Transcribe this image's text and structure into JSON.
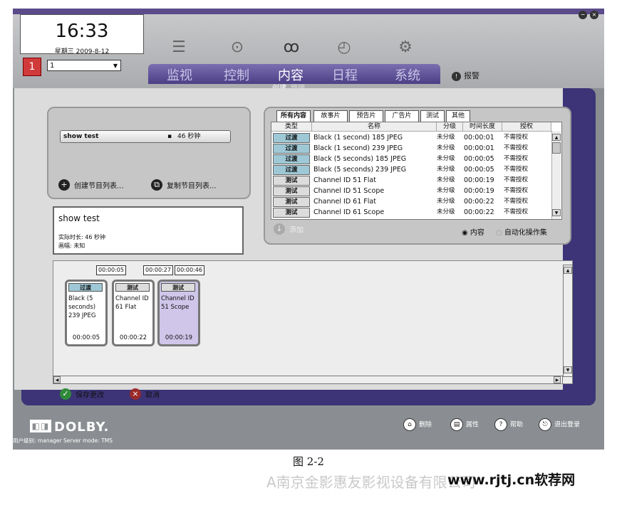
{
  "clock": {
    "time": "16:33",
    "date": "星期三 2009-8-12"
  },
  "screen": {
    "badge": "1",
    "selected": "1"
  },
  "nav": {
    "tabs": [
      "监视",
      "控制",
      "内容",
      "日程",
      "系统"
    ],
    "active": "内容",
    "alarm": "报警"
  },
  "subnav": {
    "create": "创建",
    "manage": "管理"
  },
  "playlists": {
    "items": [
      {
        "name": "show test",
        "duration": "46 秒钟"
      }
    ],
    "create_button": "创建节目列表...",
    "copy_button": "复制节目列表..."
  },
  "detail": {
    "title": "show test",
    "actual_duration": "实际时长: 46 秒钟",
    "aspect": "画幅: 未知"
  },
  "content_tabs": [
    "所有内容",
    "故事片",
    "预告片",
    "广告片",
    "测试",
    "其他"
  ],
  "content_table": {
    "headers": [
      "类型",
      "名称",
      "分级",
      "时间长度",
      "授权"
    ],
    "rows": [
      {
        "type": "过渡",
        "name": "Black (1 second) 185 JPEG",
        "rating": "未分级",
        "length": "00:00:01",
        "license": "不需授权"
      },
      {
        "type": "过渡",
        "name": "Black (1 second) 239 JPEG",
        "rating": "未分级",
        "length": "00:00:01",
        "license": "不需授权"
      },
      {
        "type": "过渡",
        "name": "Black (5 seconds) 185 JPEG",
        "rating": "未分级",
        "length": "00:00:05",
        "license": "不需授权"
      },
      {
        "type": "过渡",
        "name": "Black (5 seconds) 239 JPEG",
        "rating": "未分级",
        "length": "00:00:05",
        "license": "不需授权"
      },
      {
        "type": "测试",
        "name": "Channel ID 51 Flat",
        "rating": "未分级",
        "length": "00:00:19",
        "license": "不需授权"
      },
      {
        "type": "测试",
        "name": "Channel ID 51 Scope",
        "rating": "未分级",
        "length": "00:00:19",
        "license": "不需授权"
      },
      {
        "type": "测试",
        "name": "Channel ID 61 Flat",
        "rating": "未分级",
        "length": "00:00:22",
        "license": "不需授权"
      },
      {
        "type": "测试",
        "name": "Channel ID 61 Scope",
        "rating": "未分级",
        "length": "00:00:22",
        "license": "不需授权"
      }
    ]
  },
  "add_button": "添加",
  "radios": {
    "content": "内容",
    "automation": "自动化操作集"
  },
  "timeline": {
    "markers": [
      "00:00:05",
      "00:00:27",
      "00:00:46"
    ],
    "cards": [
      {
        "type": "过渡",
        "name": "Black (5 seconds) 239 JPEG",
        "duration": "00:00:05"
      },
      {
        "type": "测试",
        "name": "Channel ID 61 Flat",
        "duration": "00:00:22"
      },
      {
        "type": "测试",
        "name": "Channel ID 51 Scope",
        "duration": "00:00:19"
      }
    ]
  },
  "actions": {
    "save": "保存更改",
    "cancel": "取消"
  },
  "footer": {
    "brand": "DOLBY.",
    "user_info": "用户级别: manager   Server mode: TMS",
    "buttons": [
      "删除",
      "属性",
      "帮助",
      "退出登录"
    ]
  },
  "caption": "图 2-2",
  "watermark": "A南京金影惠友影视设备有限公司",
  "site": "www.rjtj.cn软荐网",
  "colors": {
    "nav_purple": "#4c3f86",
    "frame_purple": "#3c3477",
    "filter_blue": "#9ec8d6",
    "alarm_red": "#d13a3a"
  }
}
